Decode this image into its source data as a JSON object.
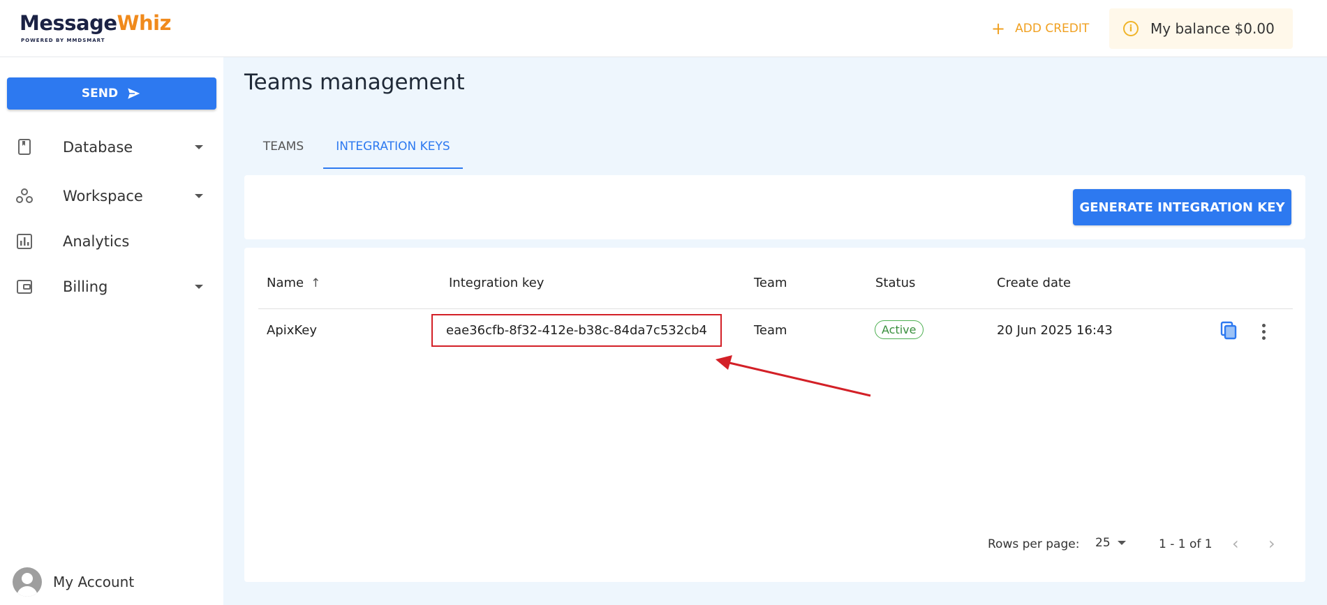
{
  "brand": {
    "logo_main": "Message",
    "logo_accent": "Whiz",
    "logo_sub": "POWERED BY MMDSMART"
  },
  "header": {
    "add_credit": "ADD CREDIT",
    "balance": "My balance $0.00"
  },
  "sidebar": {
    "send": "SEND",
    "items": [
      {
        "label": "Database",
        "icon": "book-icon"
      },
      {
        "label": "Workspace",
        "icon": "workspace-icon"
      },
      {
        "label": "Analytics",
        "icon": "analytics-icon"
      },
      {
        "label": "Billing",
        "icon": "wallet-icon"
      }
    ],
    "account": "My Account"
  },
  "page": {
    "title": "Teams management"
  },
  "tabs": [
    {
      "label": "TEAMS"
    },
    {
      "label": "INTEGRATION KEYS",
      "active": true
    }
  ],
  "actions": {
    "generate": "GENERATE INTEGRATION KEY"
  },
  "table": {
    "columns": [
      "Name",
      "Integration key",
      "Team",
      "Status",
      "Create date"
    ],
    "rows": [
      {
        "name": "ApixKey",
        "key": "eae36cfb-8f32-412e-b38c-84da7c532cb4",
        "team": "Team",
        "status": "Active",
        "date": "20 Jun 2025 16:43"
      }
    ]
  },
  "pagination": {
    "label": "Rows per page:",
    "per_page": "25",
    "range": "1 - 1 of 1"
  },
  "colors": {
    "primary": "#2d79f0",
    "accent": "#f0a020",
    "annotation": "#d32027"
  }
}
